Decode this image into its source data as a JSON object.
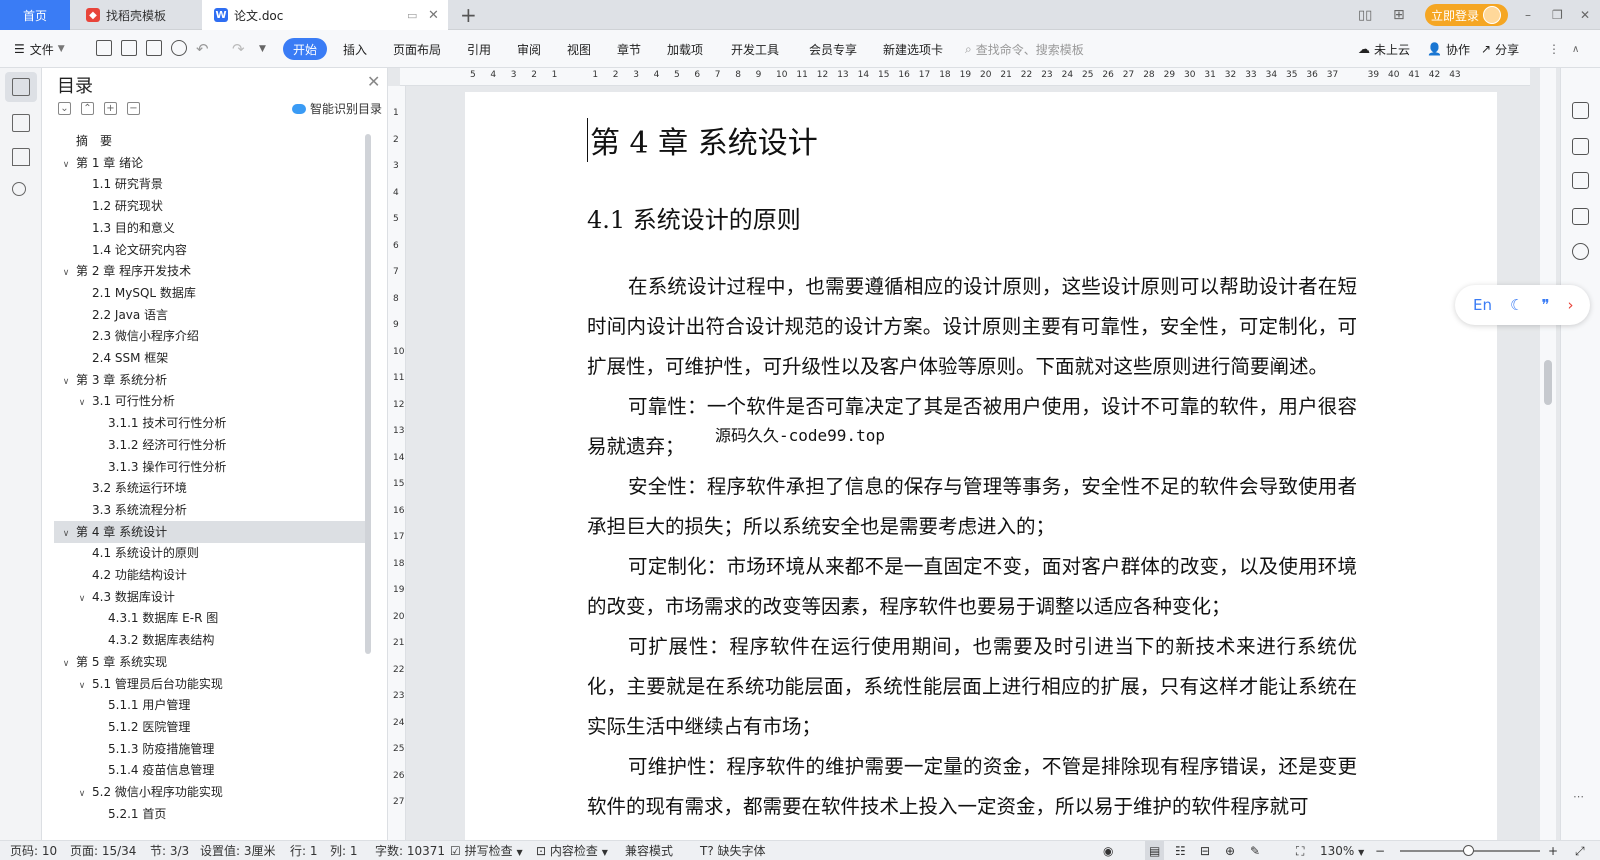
{
  "tabs": {
    "home": "首页",
    "template": "找稻壳模板",
    "document": "论文.doc",
    "new_tab": "+"
  },
  "window": {
    "login": "立即登录",
    "minimize": "–",
    "restore": "❐",
    "close": "✕"
  },
  "toolbar": {
    "file": "文件",
    "menus": [
      "开始",
      "插入",
      "页面布局",
      "引用",
      "审阅",
      "视图",
      "章节",
      "加载项",
      "开发工具",
      "会员专享",
      "新建选项卡"
    ],
    "search_placeholder": "查找命令、搜索模板",
    "cloud": "未上云",
    "collab": "协作",
    "share": "分享"
  },
  "toc": {
    "title": "目录",
    "smart": "智能识别目录",
    "items": [
      {
        "text": "摘　要",
        "level": 1,
        "expand": ""
      },
      {
        "text": "第 1 章  绪论",
        "level": 1,
        "expand": "v"
      },
      {
        "text": "1.1  研究背景",
        "level": 2,
        "expand": ""
      },
      {
        "text": "1.2  研究现状",
        "level": 2,
        "expand": ""
      },
      {
        "text": "1.3  目的和意义",
        "level": 2,
        "expand": ""
      },
      {
        "text": "1.4  论文研究内容",
        "level": 2,
        "expand": ""
      },
      {
        "text": "第 2 章  程序开发技术",
        "level": 1,
        "expand": "v"
      },
      {
        "text": "2.1 MySQL 数据库",
        "level": 2,
        "expand": ""
      },
      {
        "text": "2.2 Java 语言",
        "level": 2,
        "expand": ""
      },
      {
        "text": "2.3  微信小程序介绍",
        "level": 2,
        "expand": ""
      },
      {
        "text": "2.4 SSM 框架",
        "level": 2,
        "expand": ""
      },
      {
        "text": "第 3 章  系统分析",
        "level": 1,
        "expand": "v"
      },
      {
        "text": "3.1 可行性分析",
        "level": 2,
        "expand": "v"
      },
      {
        "text": "3.1.1 技术可行性分析",
        "level": 3,
        "expand": ""
      },
      {
        "text": "3.1.2 经济可行性分析",
        "level": 3,
        "expand": ""
      },
      {
        "text": "3.1.3 操作可行性分析",
        "level": 3,
        "expand": ""
      },
      {
        "text": "3.2 系统运行环境",
        "level": 2,
        "expand": ""
      },
      {
        "text": "3.3 系统流程分析",
        "level": 2,
        "expand": ""
      },
      {
        "text": "第 4 章  系统设计",
        "level": 1,
        "expand": "v"
      },
      {
        "text": "4.1  系统设计的原则",
        "level": 2,
        "expand": ""
      },
      {
        "text": "4.2  功能结构设计",
        "level": 2,
        "expand": ""
      },
      {
        "text": "4.3  数据库设计",
        "level": 2,
        "expand": "v"
      },
      {
        "text": "4.3.1  数据库 E-R 图",
        "level": 3,
        "expand": ""
      },
      {
        "text": "4.3.2  数据库表结构",
        "level": 3,
        "expand": ""
      },
      {
        "text": "第 5 章  系统实现",
        "level": 1,
        "expand": "v"
      },
      {
        "text": "5.1 管理员后台功能实现",
        "level": 2,
        "expand": "v"
      },
      {
        "text": "5.1.1  用户管理",
        "level": 3,
        "expand": ""
      },
      {
        "text": "5.1.2  医院管理",
        "level": 3,
        "expand": ""
      },
      {
        "text": "5.1.3  防疫措施管理",
        "level": 3,
        "expand": ""
      },
      {
        "text": "5.1.4  疫苗信息管理",
        "level": 3,
        "expand": ""
      },
      {
        "text": "5.2  微信小程序功能实现",
        "level": 2,
        "expand": "v"
      },
      {
        "text": "5.2.1  首页",
        "level": 3,
        "expand": ""
      }
    ],
    "selected_index": 18
  },
  "ruler": {
    "top": [
      "5",
      "4",
      "3",
      "2",
      "1",
      "",
      "1",
      "2",
      "3",
      "4",
      "5",
      "6",
      "7",
      "8",
      "9",
      "10",
      "11",
      "12",
      "13",
      "14",
      "15",
      "16",
      "17",
      "18",
      "19",
      "20",
      "21",
      "22",
      "23",
      "24",
      "25",
      "26",
      "27",
      "28",
      "29",
      "30",
      "31",
      "32",
      "33",
      "34",
      "35",
      "36",
      "37",
      "",
      "39",
      "40",
      "41",
      "42",
      "43"
    ],
    "left": [
      "1",
      "2",
      "3",
      "4",
      "5",
      "6",
      "7",
      "8",
      "9",
      "10",
      "11",
      "12",
      "13",
      "14",
      "15",
      "16",
      "17",
      "18",
      "19",
      "20",
      "21",
      "22",
      "23",
      "24",
      "25",
      "26",
      "27"
    ]
  },
  "document": {
    "chapter": "第 4 章  系统设计",
    "section": "4.1  系统设计的原则",
    "paragraphs": [
      "在系统设计过程中，也需要遵循相应的设计原则，这些设计原则可以帮助设计者在短时间内设计出符合设计规范的设计方案。设计原则主要有可靠性，安全性，可定制化，可扩展性，可维护性，可升级性以及客户体验等原则。下面就对这些原则进行简要阐述。",
      "可靠性：一个软件是否可靠决定了其是否被用户使用，设计不可靠的软件，用户很容易就遗弃；",
      "安全性：程序软件承担了信息的保存与管理等事务，安全性不足的软件会导致使用者承担巨大的损失；所以系统安全也是需要考虑进入的；",
      "可定制化：市场环境从来都不是一直固定不变，面对客户群体的改变，以及使用环境的改变，市场需求的改变等因素，程序软件也要易于调整以适应各种变化；",
      "可扩展性：程序软件在运行使用期间，也需要及时引进当下的新技术来进行系统优化，主要就是在系统功能层面，系统性能层面上进行相应的扩展，只有这样才能让系统在实际生活中继续占有市场；",
      "可维护性：程序软件的维护需要一定量的资金，不管是排除现有程序错误，还是变更软件的现有需求，都需要在软件技术上投入一定资金，所以易于维护的软件程序就可"
    ],
    "watermark": "源码久久-code99.top"
  },
  "floating": {
    "lang": "En"
  },
  "status": {
    "page_code": "页码: 10",
    "page": "页面: 15/34",
    "section": "节: 3/3",
    "setting": "设置值: 3厘米",
    "row": "行: 1",
    "col": "列: 1",
    "words": "字数: 10371",
    "spell": "拼写检查",
    "content_check": "内容检查",
    "compat": "兼容模式",
    "missing_font": "缺失字体",
    "zoom": "130%"
  },
  "colors": {
    "accent": "#3a7cf5",
    "login": "#f5a623"
  }
}
